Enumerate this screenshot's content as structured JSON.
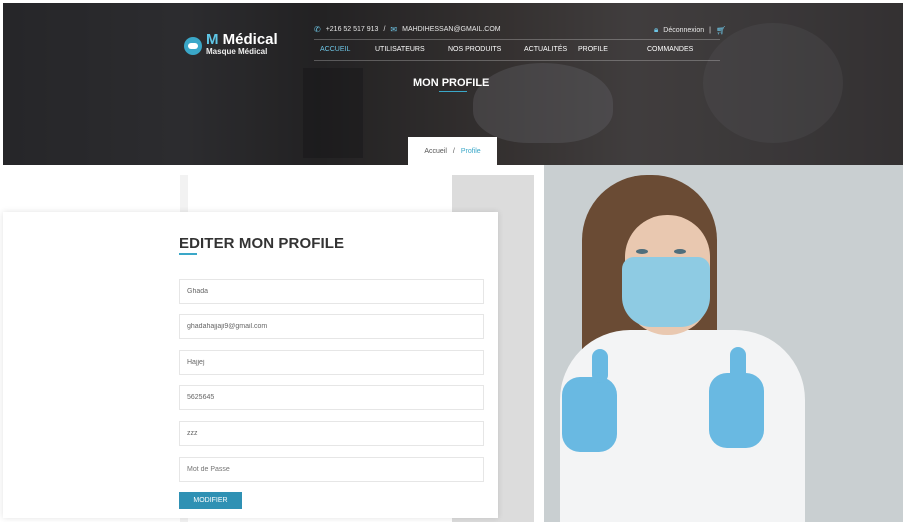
{
  "brand": {
    "title_prefix": "M",
    "title_rest": " Médical",
    "subtitle": "Masque Médical"
  },
  "topbar": {
    "phone": "+216 52 517 913",
    "separator": "/",
    "email": "MAHDIHESSAN@GMAIL.COM",
    "logout": "Déconnexion",
    "divider": "|"
  },
  "nav": [
    {
      "label": "ACCUEIL",
      "active": true
    },
    {
      "label": "UTILISATEURS",
      "active": false
    },
    {
      "label": "NOS PRODUITS",
      "active": false
    },
    {
      "label": "ACTUALITÉS",
      "active": false
    },
    {
      "label": "PROFILE",
      "active": false
    },
    {
      "label": "COMMANDES",
      "active": false
    }
  ],
  "page_title": "MON PROFILE",
  "breadcrumb": {
    "home": "Accueil",
    "separator": "/",
    "current": "Profile"
  },
  "form": {
    "title": "EDITER MON PROFILE",
    "fields": [
      {
        "name": "first-name",
        "value": "Ghada"
      },
      {
        "name": "email",
        "value": "ghadahajjaji9@gmail.com"
      },
      {
        "name": "last-name",
        "value": "Hajjej"
      },
      {
        "name": "phone",
        "value": "5625645"
      },
      {
        "name": "address",
        "value": "zzz"
      },
      {
        "name": "password",
        "placeholder": "Mot de Passe"
      }
    ],
    "submit": "MODIFIER"
  },
  "colors": {
    "accent": "#3aa7c8",
    "button": "#2f91b4"
  },
  "icons": {
    "phone": "phone-icon",
    "email": "envelope-icon",
    "lock": "lock-icon",
    "cart": "cart-icon",
    "logo": "shield-mask-icon"
  }
}
